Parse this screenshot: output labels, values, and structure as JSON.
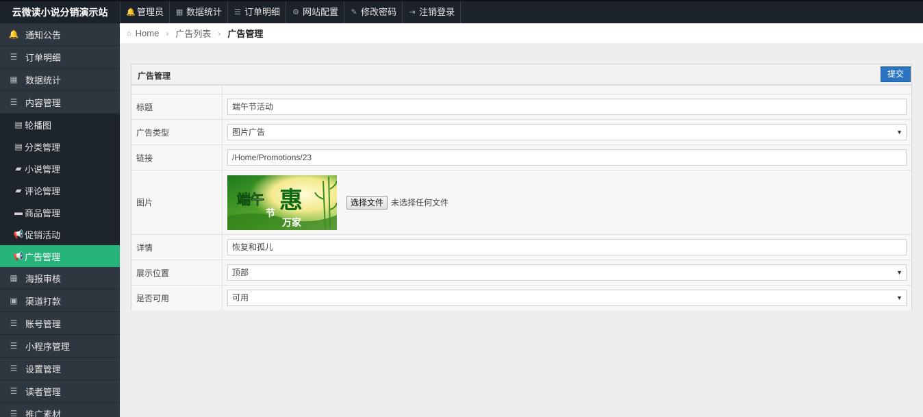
{
  "brand": "云微读小说分销演示站",
  "topnav": [
    {
      "label": "管理员",
      "icon": "bell-icon",
      "glyph": "🔔"
    },
    {
      "label": "数据统计",
      "icon": "bar-chart-icon",
      "glyph": "▦"
    },
    {
      "label": "订单明细",
      "icon": "list-icon",
      "glyph": "☰"
    },
    {
      "label": "网站配置",
      "icon": "gear-icon",
      "glyph": "⚙"
    },
    {
      "label": "修改密码",
      "icon": "edit-icon",
      "glyph": "✎"
    },
    {
      "label": "注销登录",
      "icon": "sign-out-icon",
      "glyph": "⇥"
    }
  ],
  "sidebar": {
    "items": [
      {
        "label": "通知公告",
        "icon": "bell-icon",
        "glyph": "🔔"
      },
      {
        "label": "订单明细",
        "icon": "list-icon",
        "glyph": "☰"
      },
      {
        "label": "数据统计",
        "icon": "bar-chart-icon",
        "glyph": "▦"
      },
      {
        "label": "内容管理",
        "icon": "list-icon",
        "glyph": "☰"
      }
    ],
    "subitems": [
      {
        "label": "轮播图",
        "icon": "image-list-icon",
        "glyph": "▤"
      },
      {
        "label": "分类管理",
        "icon": "image-list-icon",
        "glyph": "▤"
      },
      {
        "label": "小说管理",
        "icon": "book-icon",
        "glyph": "▰"
      },
      {
        "label": "评论管理",
        "icon": "book-icon",
        "glyph": "▰"
      },
      {
        "label": "商品管理",
        "icon": "truck-icon",
        "glyph": "▬"
      },
      {
        "label": "促销活动",
        "icon": "bullhorn-icon",
        "glyph": "📢"
      },
      {
        "label": "广告管理",
        "icon": "bullhorn-icon",
        "glyph": "📢",
        "active": true
      }
    ],
    "items2": [
      {
        "label": "海报审核",
        "icon": "grid-icon",
        "glyph": "▦"
      },
      {
        "label": "渠道打款",
        "icon": "money-icon",
        "glyph": "▣"
      },
      {
        "label": "账号管理",
        "icon": "list-icon",
        "glyph": "☰"
      },
      {
        "label": "小程序管理",
        "icon": "list-icon",
        "glyph": "☰"
      },
      {
        "label": "设置管理",
        "icon": "list-icon",
        "glyph": "☰"
      },
      {
        "label": "读者管理",
        "icon": "list-icon",
        "glyph": "☰"
      },
      {
        "label": "推广素材",
        "icon": "list-icon",
        "glyph": "☰"
      }
    ]
  },
  "breadcrumb": {
    "home": "Home",
    "list": "广告列表",
    "current": "广告管理"
  },
  "panel": {
    "title": "广告管理",
    "submit_label": "提交"
  },
  "form": {
    "title_label": "标题",
    "title_value": "端午节活动",
    "type_label": "广告类型",
    "type_value": "图片广告",
    "link_label": "链接",
    "link_value": "/Home/Promotions/23",
    "image_label": "图片",
    "image_text_1": "端午",
    "image_text_2": "节",
    "image_text_3": "惠",
    "image_text_4": "万家",
    "file_button": "选择文件",
    "file_status": "未选择任何文件",
    "detail_label": "详情",
    "detail_value": "恢复和孤儿",
    "position_label": "展示位置",
    "position_value": "顶部",
    "enabled_label": "是否可用",
    "enabled_value": "可用"
  },
  "colors": {
    "topbar": "#1c2229",
    "sidebar": "#2e363f",
    "sidebar_sub": "#1e242b",
    "active": "#27b47a",
    "submit": "#2a74c2"
  }
}
